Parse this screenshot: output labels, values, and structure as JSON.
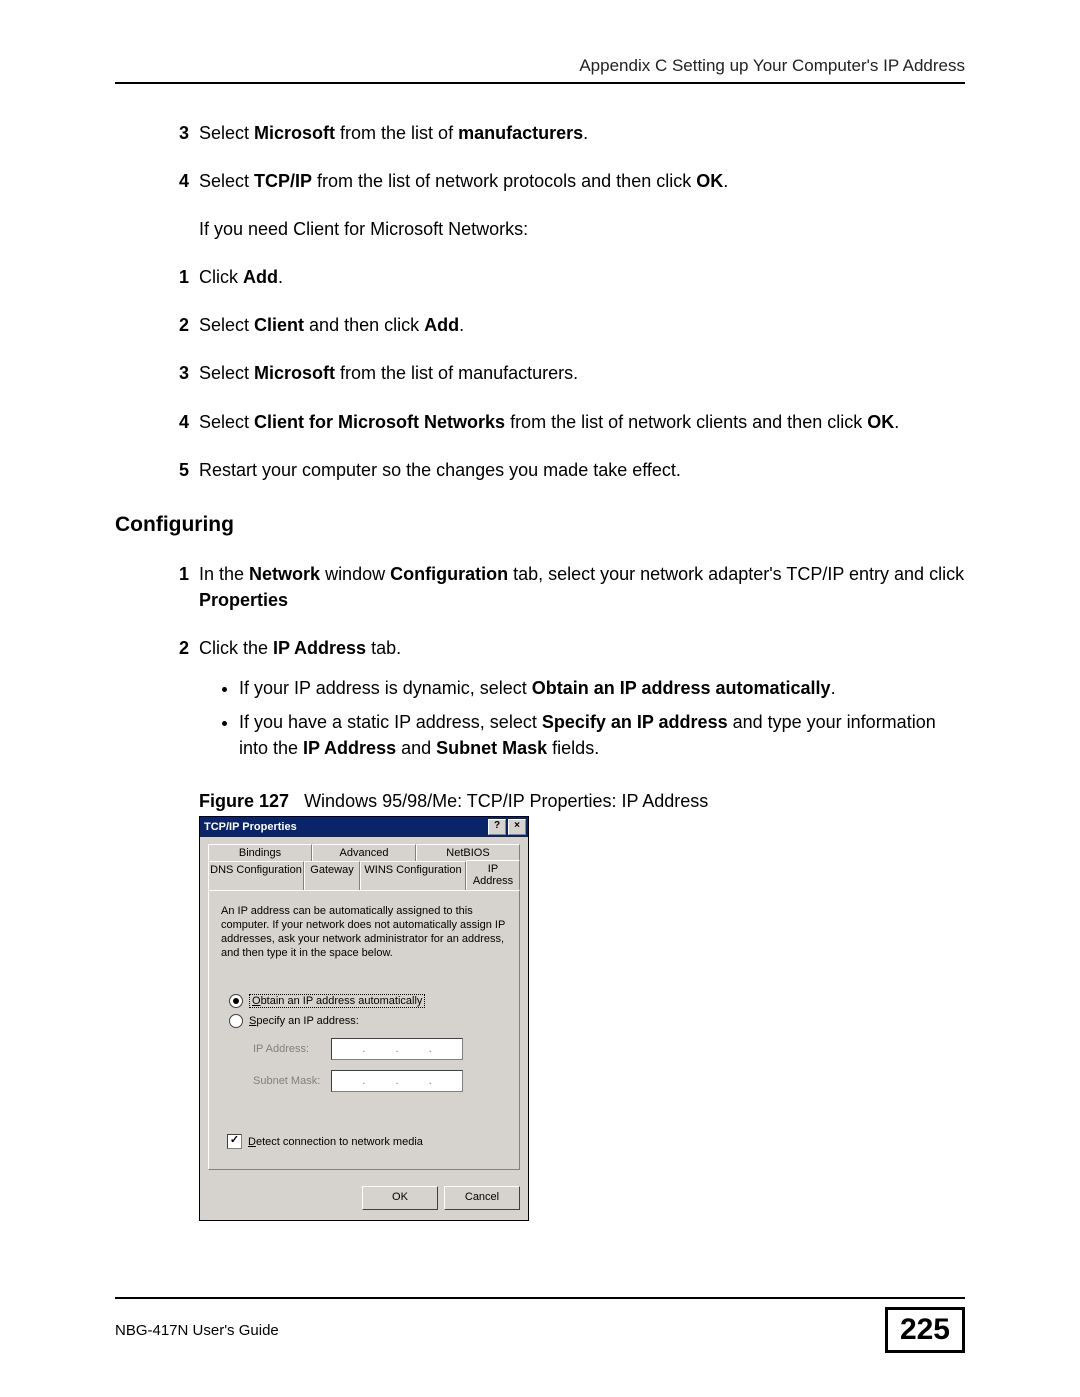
{
  "header": {
    "appendix": "Appendix C Setting up Your Computer's IP Address"
  },
  "steps_a": [
    {
      "num": "3",
      "html": "Select <b>Microsoft</b> from the list of <b>manufacturers</b>."
    },
    {
      "num": "4",
      "html": "Select <b>TCP/IP</b> from the list of network protocols and then click <b>OK</b>."
    }
  ],
  "para_need": "If you need Client for Microsoft Networks:",
  "steps_b": [
    {
      "num": "1",
      "html": "Click <b>Add</b>."
    },
    {
      "num": "2",
      "html": "Select <b>Client</b> and then click <b>Add</b>."
    },
    {
      "num": "3",
      "html": "Select <b>Microsoft</b> from the list of manufacturers."
    },
    {
      "num": "4",
      "html": "Select <b>Client for Microsoft Networks</b> from the list of network clients and then click <b>OK</b>."
    },
    {
      "num": "5",
      "html": "Restart your computer so the changes you made take effect."
    }
  ],
  "section": "Configuring",
  "steps_c": [
    {
      "num": "1",
      "html": "In the <b>Network</b> window <b>Configuration</b> tab, select your network adapter's TCP/IP entry and click <b>Properties</b>"
    },
    {
      "num": "2",
      "html": "Click the <b>IP Address</b> tab.",
      "bullets": [
        "If your IP address is dynamic, select <b>Obtain an IP address automatically</b>.",
        "If you have a static IP address, select <b>Specify an IP address</b> and type your information into the <b>IP Address</b> and <b>Subnet Mask</b> fields."
      ]
    }
  ],
  "figure": {
    "label": "Figure 127",
    "caption": "Windows 95/98/Me: TCP/IP Properties: IP Address"
  },
  "dialog": {
    "title": "TCP/IP Properties",
    "help_icon": "?",
    "close_icon": "×",
    "tabs_row1": [
      "Bindings",
      "Advanced",
      "NetBIOS"
    ],
    "tabs_row2": [
      "DNS Configuration",
      "Gateway",
      "WINS Configuration",
      "IP Address"
    ],
    "active_tab": "IP Address",
    "desc": "An IP address can be automatically assigned to this computer. If your network does not automatically assign IP addresses, ask your network administrator for an address, and then type it in the space below.",
    "radio1": "Obtain an IP address automatically",
    "radio2": "Specify an IP address:",
    "field_ip": "IP Address:",
    "field_mask": "Subnet Mask:",
    "checkbox": "Detect connection to network media",
    "checkbox_checked": true,
    "ok": "OK",
    "cancel": "Cancel"
  },
  "footer": {
    "guide": "NBG-417N User's Guide",
    "page": "225"
  }
}
